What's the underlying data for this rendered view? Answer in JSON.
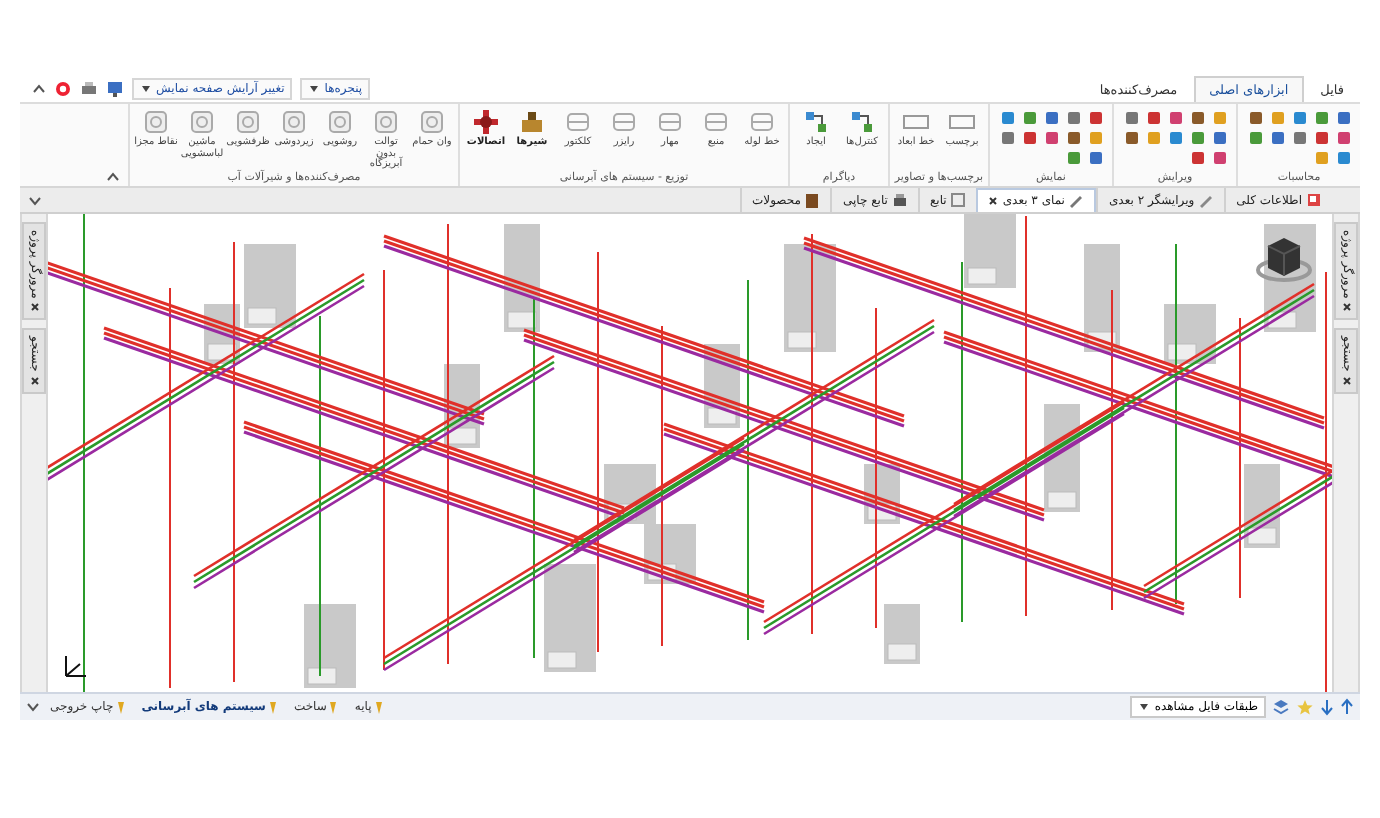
{
  "quick_access": {
    "windows_menu": "پنجره‌ها",
    "layout_menu": "تغییر آرایش صفحه نمایش"
  },
  "menu_tabs": [
    {
      "label": "فایل",
      "selected": false
    },
    {
      "label": "ابزارهای اصلی",
      "selected": true
    },
    {
      "label": "مصرف‌کننده‌ها",
      "selected": false
    }
  ],
  "ribbon_groups": [
    {
      "title": "محاسبات",
      "kind": "small"
    },
    {
      "title": "ویرایش",
      "kind": "small"
    },
    {
      "title": "نمایش",
      "kind": "small"
    },
    {
      "title": "برچسب‌ها و تصاویر",
      "kind": "large",
      "buttons": [
        "برچسب",
        "خط ابعاد"
      ]
    },
    {
      "title": "دیاگرام",
      "kind": "large",
      "buttons": [
        "کنترل‌ها",
        "ایجاد"
      ]
    },
    {
      "title": "توزیع - سیستم های آبرسانی",
      "kind": "large",
      "buttons": [
        "خط لوله",
        "منبع",
        "مهار",
        "رایزر",
        "کلکتور",
        "شیرها",
        "اتصالات"
      ]
    },
    {
      "title": "مصرف‌کننده‌ها و شیرآلات آب",
      "kind": "large",
      "buttons": [
        "وان حمام",
        "توالت بدون آبریزگاه",
        "روشویی",
        "زیردوشی",
        "ظرفشویی",
        "ماشین لباسشویی",
        "نقاط مجزا"
      ]
    }
  ],
  "doc_tabs": [
    {
      "label": "اطلاعات کلی",
      "selected": false
    },
    {
      "label": "ویرایشگر ۲ بعدی",
      "selected": false
    },
    {
      "label": "نمای ۳ بعدی",
      "selected": true
    },
    {
      "label": "تابع",
      "selected": false
    },
    {
      "label": "تابع چاپی",
      "selected": false
    },
    {
      "label": "محصولات",
      "selected": false
    }
  ],
  "left_panel": [
    "مرورگر پروژه",
    "جستجو"
  ],
  "right_panel": [
    "مرورگر پروژه",
    "جستجو"
  ],
  "status_bar": {
    "view_levels": "طبقات فایل مشاهده",
    "tabs": [
      {
        "label": "پایه",
        "selected": false
      },
      {
        "label": "ساخت",
        "selected": false
      },
      {
        "label": "سیستم های آبرسانی",
        "selected": true
      },
      {
        "label": "چاپ خروجی",
        "selected": false
      }
    ]
  }
}
